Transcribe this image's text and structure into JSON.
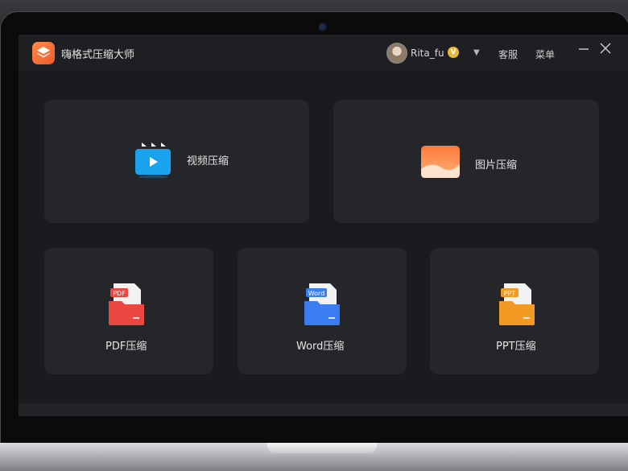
{
  "app": {
    "title": "嗨格式压缩大师"
  },
  "header": {
    "username": "Rita_fu",
    "vip_badge": "V",
    "service_label": "客服",
    "menu_label": "菜单"
  },
  "cards": {
    "video": {
      "label": "视频压缩"
    },
    "image": {
      "label": "图片压缩"
    },
    "pdf": {
      "label": "PDF压缩",
      "badge": "PDF"
    },
    "word": {
      "label": "Word压缩",
      "badge": "Word"
    },
    "ppt": {
      "label": "PPT压缩",
      "badge": "PPT"
    }
  },
  "colors": {
    "accent_orange": "#f26a33",
    "video_blue": "#1aa3ef",
    "pdf_red": "#e9473f",
    "word_blue": "#3a7df0",
    "ppt_orange": "#f39a24"
  },
  "icons": {
    "app_logo": "layers-icon",
    "video": "clapperboard-play-icon",
    "image": "landscape-image-icon",
    "pdf": "pdf-file-folder-icon",
    "word": "word-file-folder-icon",
    "ppt": "ppt-file-folder-icon"
  }
}
